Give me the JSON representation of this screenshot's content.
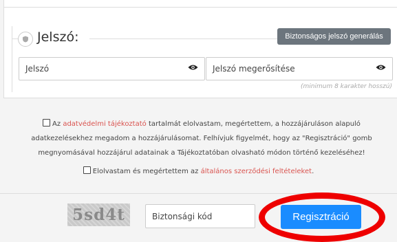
{
  "password_section": {
    "title": "Jelszó:",
    "generate_button": "Biztonságos jelszó generálás",
    "password_placeholder": "Jelszó",
    "confirm_placeholder": "Jelszó megerősítése",
    "hint": "(minimum 8 karakter hosszú)"
  },
  "consent": {
    "part1": "Az ",
    "link1": "adatvédelmi tájékoztató",
    "part2": " tartalmát elolvastam, megértettem, a hozzájáruláson alapuló adatkezelésekhez megadom a hozzájárulásomat. Felhívjuk figyelmét, hogy az \"Regisztráció\" gomb megnyomásával hozzájárul adatainak a Tájékoztatóban olvasható módon történő kezeléséhez!",
    "terms_part1": "Elolvastam és megértettem az ",
    "terms_link": "általános szerződési feltételeket",
    "terms_part2": "."
  },
  "captcha": {
    "text": "5sd4t",
    "input_placeholder": "Biztonsági kód"
  },
  "register_button": "Regisztráció",
  "colors": {
    "link": "#d9534f",
    "primary": "#1a8cff",
    "annotation": "#ee0000"
  }
}
